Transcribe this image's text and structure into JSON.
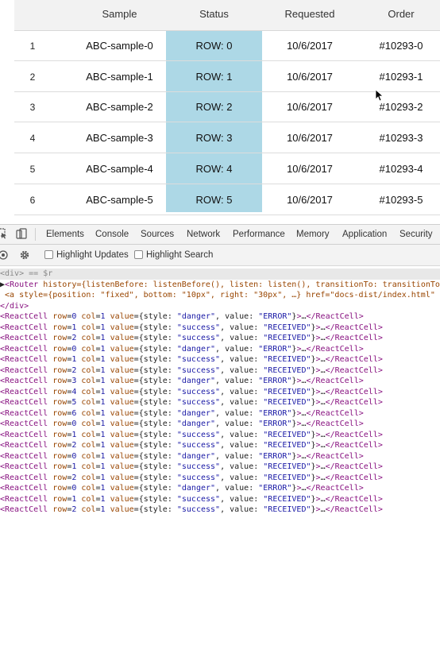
{
  "table": {
    "headers": {
      "sample": "Sample",
      "status": "Status",
      "requested": "Requested",
      "order": "Order"
    },
    "rows": [
      {
        "index": "1",
        "sample": "ABC-sample-0",
        "status": "ROW: 0",
        "requested": "10/6/2017",
        "order": "#10293-0"
      },
      {
        "index": "2",
        "sample": "ABC-sample-1",
        "status": "ROW: 1",
        "requested": "10/6/2017",
        "order": "#10293-1"
      },
      {
        "index": "3",
        "sample": "ABC-sample-2",
        "status": "ROW: 2",
        "requested": "10/6/2017",
        "order": "#10293-2"
      },
      {
        "index": "4",
        "sample": "ABC-sample-3",
        "status": "ROW: 3",
        "requested": "10/6/2017",
        "order": "#10293-3"
      },
      {
        "index": "5",
        "sample": "ABC-sample-4",
        "status": "ROW: 4",
        "requested": "10/6/2017",
        "order": "#10293-4"
      },
      {
        "index": "6",
        "sample": "ABC-sample-5",
        "status": "ROW: 5",
        "requested": "10/6/2017",
        "order": "#10293-5"
      }
    ],
    "status_column_color": "#add8e6"
  },
  "devtools": {
    "tabs": [
      "Elements",
      "Console",
      "Sources",
      "Network",
      "Performance",
      "Memory",
      "Application",
      "Security"
    ],
    "toolbar": {
      "highlight_updates": "Highlight Updates",
      "highlight_search": "Highlight Search"
    },
    "tree": {
      "selected": "<div> == $r",
      "router_tag": "Router",
      "router_attrs": " history={listenBefore: listenBefore(), listen: listen(), transitionTo: transitionTo(",
      "anchor_line": " <a style={position: \"fixed\", bottom: \"10px\", right: \"30px\", …} href=\"docs-dist/index.html\" r",
      "close_div": "</div>",
      "react_cells": [
        {
          "row": "0",
          "col": "1",
          "style": "danger",
          "value": "ERROR"
        },
        {
          "row": "1",
          "col": "1",
          "style": "success",
          "value": "RECEIVED"
        },
        {
          "row": "2",
          "col": "1",
          "style": "success",
          "value": "RECEIVED"
        },
        {
          "row": "0",
          "col": "1",
          "style": "danger",
          "value": "ERROR"
        },
        {
          "row": "1",
          "col": "1",
          "style": "success",
          "value": "RECEIVED"
        },
        {
          "row": "2",
          "col": "1",
          "style": "success",
          "value": "RECEIVED"
        },
        {
          "row": "3",
          "col": "1",
          "style": "danger",
          "value": "ERROR"
        },
        {
          "row": "4",
          "col": "1",
          "style": "success",
          "value": "RECEIVED"
        },
        {
          "row": "5",
          "col": "1",
          "style": "success",
          "value": "RECEIVED"
        },
        {
          "row": "6",
          "col": "1",
          "style": "danger",
          "value": "ERROR"
        },
        {
          "row": "0",
          "col": "1",
          "style": "danger",
          "value": "ERROR"
        },
        {
          "row": "1",
          "col": "1",
          "style": "success",
          "value": "RECEIVED"
        },
        {
          "row": "2",
          "col": "1",
          "style": "success",
          "value": "RECEIVED"
        },
        {
          "row": "0",
          "col": "1",
          "style": "danger",
          "value": "ERROR"
        },
        {
          "row": "1",
          "col": "1",
          "style": "success",
          "value": "RECEIVED"
        },
        {
          "row": "2",
          "col": "1",
          "style": "success",
          "value": "RECEIVED"
        },
        {
          "row": "0",
          "col": "1",
          "style": "danger",
          "value": "ERROR"
        },
        {
          "row": "1",
          "col": "1",
          "style": "success",
          "value": "RECEIVED"
        },
        {
          "row": "2",
          "col": "1",
          "style": "success",
          "value": "RECEIVED"
        }
      ]
    }
  }
}
